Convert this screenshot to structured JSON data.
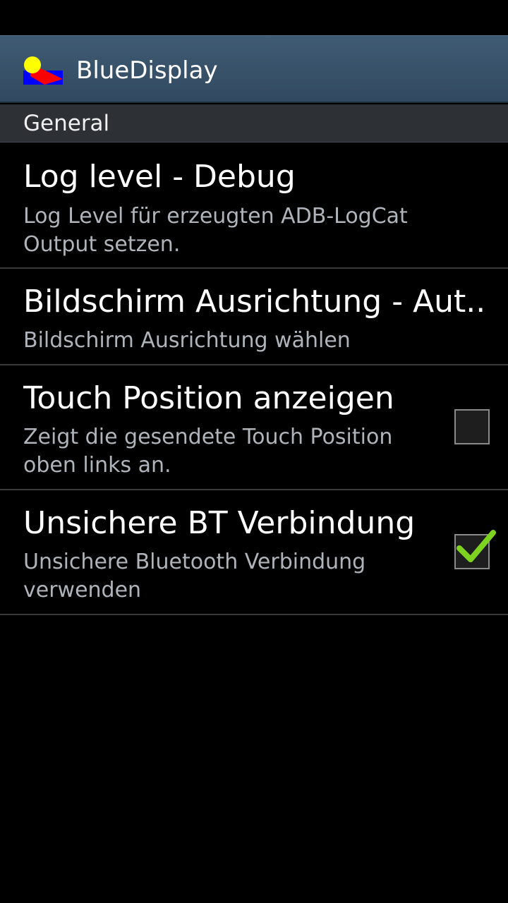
{
  "app": {
    "title": "BlueDisplay",
    "icon": "bluedisplay-logo"
  },
  "section": {
    "label": "General"
  },
  "preferences": [
    {
      "title": "Log level  - Debug",
      "summary": "Log Level für erzeugten ADB-LogCat Output setzen."
    },
    {
      "title": "Bildschirm Ausrichtung  - Aut..",
      "summary": "Bildschirm Ausrichtung wählen"
    },
    {
      "title": "Touch Position anzeigen",
      "summary": "Zeigt die gesendete Touch Position oben links an.",
      "checked": false
    },
    {
      "title": "Unsichere BT Verbindung",
      "summary": "Unsichere Bluetooth Verbindung verwenden",
      "checked": true
    }
  ],
  "colors": {
    "action_bar": "#3a5369",
    "section_bg": "#2d3035",
    "summary_text": "#aeb4ba",
    "check_green": "#7ed321"
  }
}
